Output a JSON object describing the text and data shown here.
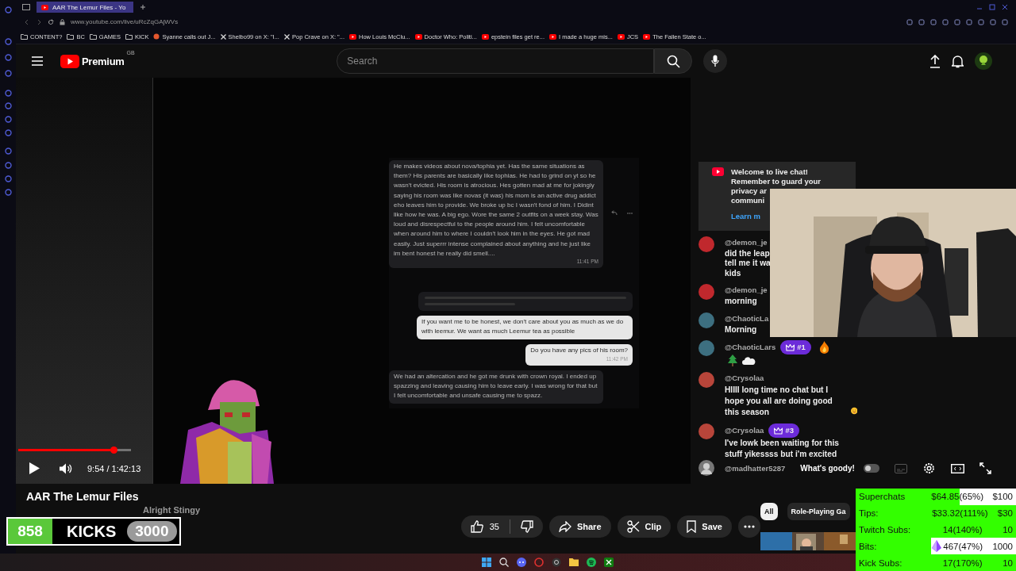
{
  "browser": {
    "tab_title": "AAR The Lemur Files - Yo",
    "url": "www.youtube.com/live/uRcZqGAjWVs",
    "bookmarks": [
      {
        "label": "CONTENT?",
        "kind": "folder"
      },
      {
        "label": "BC",
        "kind": "folder"
      },
      {
        "label": "GAMES",
        "kind": "folder"
      },
      {
        "label": "KICK",
        "kind": "folder"
      },
      {
        "label": "Syanne calls out J...",
        "kind": "site"
      },
      {
        "label": "Shelbo99 on X: \"I...",
        "kind": "x"
      },
      {
        "label": "Pop Crave on X: \"...",
        "kind": "x"
      },
      {
        "label": "How Louis McClu...",
        "kind": "video"
      },
      {
        "label": "Doctor Who: Politi...",
        "kind": "video"
      },
      {
        "label": "epstein files get re...",
        "kind": "video"
      },
      {
        "label": "I made a huge mis...",
        "kind": "video"
      },
      {
        "label": "JCS",
        "kind": "video"
      },
      {
        "label": "The Fallen State o...",
        "kind": "video"
      }
    ]
  },
  "header": {
    "logo": "Premium",
    "region": "GB",
    "search": {
      "placeholder": "Search"
    }
  },
  "shared_chat": [
    {
      "kind": "incoming",
      "text": "He makes videos about nova/tophia yet. Has the same situations as them? His parents are basically like tophias. He had to grind on yt so he wasn't evicted. His room is atrocious. Hes gotten mad at me for jokingly saying his room was like novas (it was) his mom is an active drug addict eho leaves him to provide. We broke up bc I wasn't fond of him. I Didint like how he was. A big ego. Wore the same 2 outfits on a week stay. Was loud and disrespectful to the people around him. I felt uncomfortable when around him to where I couldn't look him in the eyes. He got mad easily. Just superrr intense complained about anything and he just like im bent honest he really did smell....",
      "time": "11:41 PM"
    },
    {
      "kind": "blurred"
    },
    {
      "kind": "outgoing",
      "text": "If you want me to be honest, we don't care about you as much as we do with leemur. We want as much Leemur tea as possible"
    },
    {
      "kind": "outgoing",
      "text": "Do you have any pics of his room?",
      "time": "11:42 PM"
    },
    {
      "kind": "incoming",
      "text": "We had an altercation and he got me drunk with crown royal. I ended up spazzing and leaving causing him to leave early. I was wrong for that but I felt uncomfortable and unsafe causing me to spazz."
    }
  ],
  "player": {
    "progress": {
      "level": 0.845
    },
    "time": "9:54 / 1:42:13",
    "autoplay": {
      "on": false
    }
  },
  "chat": {
    "welcome": [
      "Welcome to live chat!",
      "Remember to guard your",
      "privacy ar",
      "communi"
    ],
    "learn_more": "Learn m",
    "messages": [
      {
        "author": "@demon_je",
        "lines": [
          "did the leap",
          "tell me it wa",
          "kids"
        ],
        "color": "#c0282d",
        "kind": "text"
      },
      {
        "author": "@demon_je",
        "lines": [
          "morning"
        ],
        "color": "#c0282d",
        "kind": "text"
      },
      {
        "author": "@ChaoticLa",
        "lines": [
          "Morning"
        ],
        "color": "#3d6f80",
        "kind": "text"
      },
      {
        "author": "@ChaoticLars",
        "badge": "#1",
        "color": "#3d6f80",
        "kind": "emoji-line"
      },
      {
        "author": "@Crysolaa",
        "text": "HIIII long time no chat but I hope you all are doing good this season",
        "color": "#b8453a",
        "kind": "text-emoji"
      },
      {
        "author": "@Crysolaa",
        "badge": "#3",
        "text": "I've lowk been waiting for this stuff yikessss but i'm excited",
        "color": "#b8453a",
        "kind": "text"
      }
    ],
    "latest": {
      "author": "@madhatter5287",
      "text": "What's goody!"
    }
  },
  "video": {
    "title": "AAR The Lemur Files",
    "channel": "Alright Stingy",
    "likes": "35",
    "actions": [
      "Share",
      "Clip",
      "Save"
    ]
  },
  "chips": [
    {
      "label": "All",
      "selected": true
    },
    {
      "label": "Role-Playing Ga",
      "selected": false
    }
  ],
  "kicks_overlay": {
    "count": "858",
    "label": "KICKS",
    "goal": "3000"
  },
  "goals": [
    {
      "label": "Superchats",
      "value": "$64.85(65%)",
      "target": "$100",
      "level": 0.65,
      "kind": "plain"
    },
    {
      "label": "Tips:",
      "value": "$33.32(111%)",
      "target": "$30",
      "level": 1,
      "kind": "plain"
    },
    {
      "label": "Twitch Subs:",
      "value": "14(140%)",
      "target": "10",
      "level": 1,
      "kind": "plain"
    },
    {
      "label": "Bits:",
      "value": "467(47%)",
      "target": "1000",
      "level": 0.47,
      "kind": "bits"
    },
    {
      "label": "Kick Subs:",
      "value": "17(170%)",
      "target": "10",
      "level": 1,
      "kind": "plain"
    }
  ]
}
